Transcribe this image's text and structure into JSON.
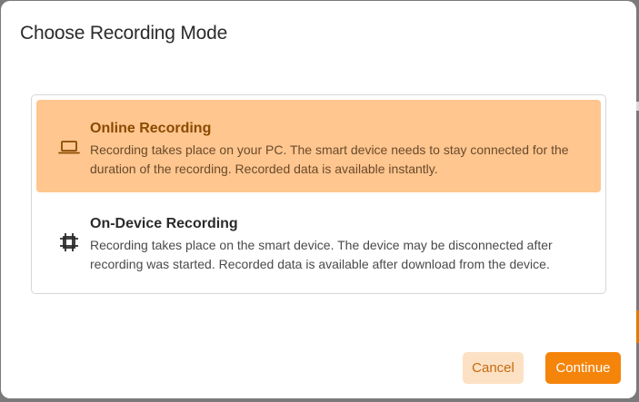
{
  "dialog": {
    "title": "Choose Recording Mode"
  },
  "options": [
    {
      "title": "Online Recording",
      "description": "Recording takes place on your PC. The smart device needs to stay connected for the duration of the recording. Recorded data is available instantly.",
      "icon": "laptop-icon",
      "selected": true
    },
    {
      "title": "On-Device Recording",
      "description": "Recording takes place on the smart device. The device may be disconnected after recording was started. Recorded data is available after download from the device.",
      "icon": "chip-icon",
      "selected": false
    }
  ],
  "buttons": {
    "cancel_label": "Cancel",
    "continue_label": "Continue"
  },
  "colors": {
    "accent": "#f5840a",
    "selected_bg": "#ffc68f",
    "cancel_bg": "#fde1c4"
  }
}
